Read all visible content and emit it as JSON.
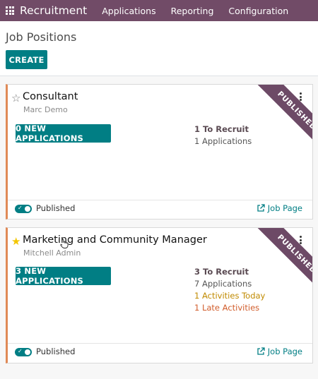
{
  "topbar": {
    "app_name": "Recruitment",
    "menu": [
      "Applications",
      "Reporting",
      "Configuration"
    ]
  },
  "control_panel": {
    "title": "Job Positions",
    "create_label": "CREATE"
  },
  "jobs": [
    {
      "title": "Consultant",
      "subtitle": "Marc Demo",
      "favorite": false,
      "ribbon": "PUBLISHED",
      "new_applications_label": "0 NEW APPLICATIONS",
      "to_recruit": "1 To Recruit",
      "applications": "1 Applications",
      "published_label": "Published",
      "published": true,
      "job_page_label": "Job Page"
    },
    {
      "title": "Marketing and Community Manager",
      "subtitle": "Mitchell Admin",
      "favorite": true,
      "ribbon": "PUBLISHED",
      "new_applications_label": "3 NEW APPLICATIONS",
      "to_recruit": "3 To Recruit",
      "applications": "7 Applications",
      "activities_today": "1 Activities Today",
      "late_activities": "1 Late Activities",
      "published_label": "Published",
      "published": true,
      "job_page_label": "Job Page"
    }
  ],
  "colors": {
    "brand": "#714b67",
    "primary": "#017e84",
    "ribbon": "#6d4a66",
    "card_accent": "#e08a57",
    "activity_today": "#c08a00",
    "activity_late": "#d15d2c"
  }
}
